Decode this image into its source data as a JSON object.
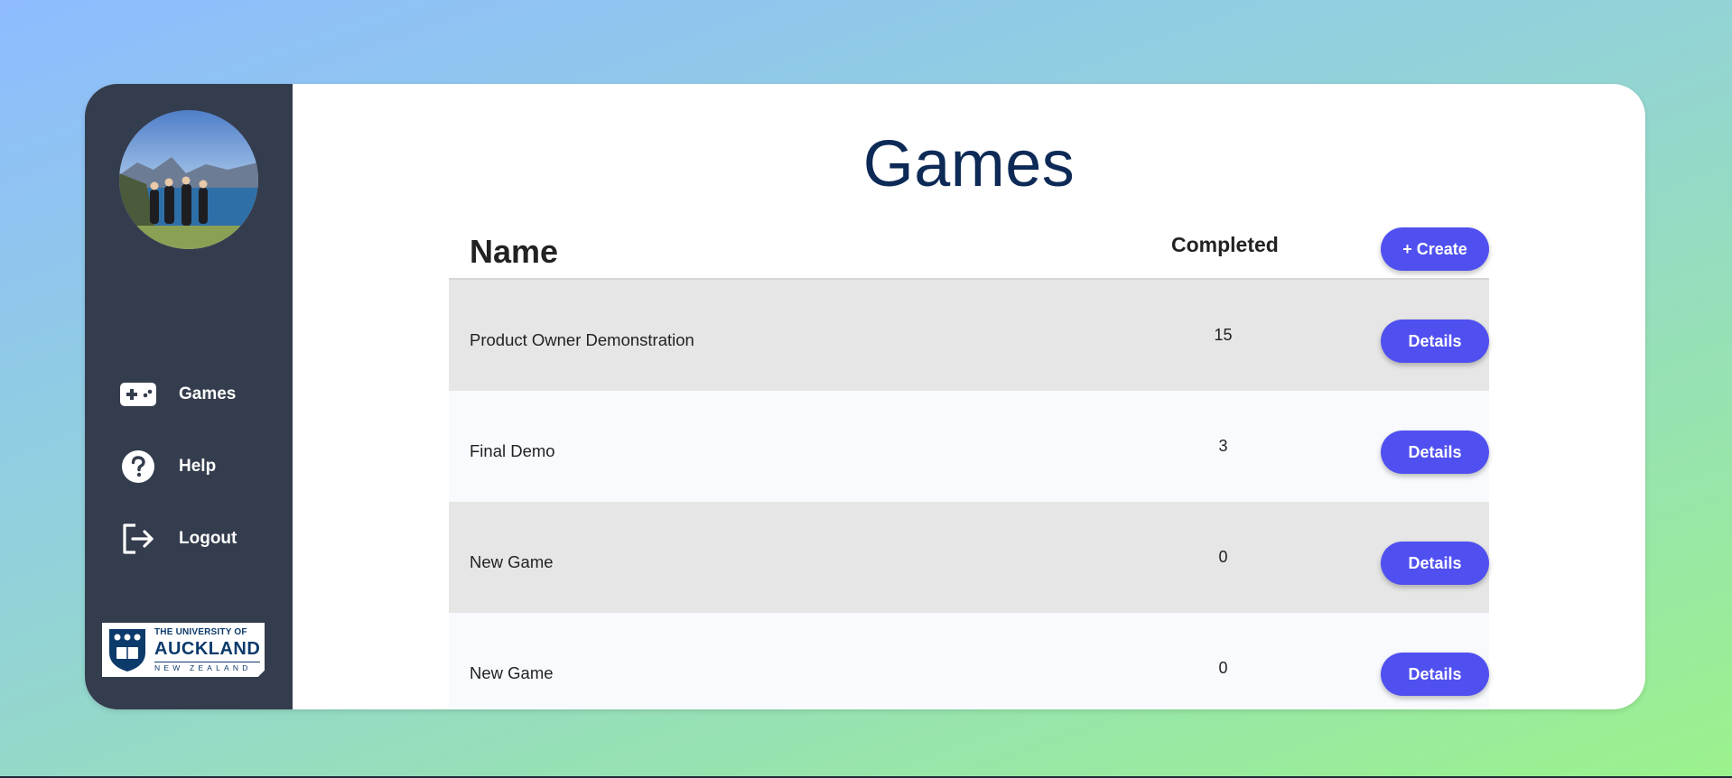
{
  "sidebar": {
    "nav": [
      {
        "label": "Games",
        "icon": "gamepad-icon"
      },
      {
        "label": "Help",
        "icon": "help-icon"
      },
      {
        "label": "Logout",
        "icon": "logout-icon"
      }
    ],
    "logo": {
      "line1": "THE UNIVERSITY OF",
      "line2": "AUCKLAND",
      "line3": "NEW ZEALAND"
    }
  },
  "main": {
    "title": "Games",
    "table": {
      "col_name": "Name",
      "col_completed": "Completed",
      "create_label": "+ Create",
      "details_label": "Details",
      "rows": [
        {
          "name": "Product Owner Demonstration",
          "completed": "15"
        },
        {
          "name": "Final Demo",
          "completed": "3"
        },
        {
          "name": "New Game",
          "completed": "0"
        },
        {
          "name": "New Game",
          "completed": "0"
        }
      ]
    }
  },
  "colors": {
    "sidebar_bg": "#343d4d",
    "button": "#5050f0",
    "title": "#0d2a57",
    "row_odd": "#e6e6e6",
    "row_even": "#f8fafd"
  }
}
